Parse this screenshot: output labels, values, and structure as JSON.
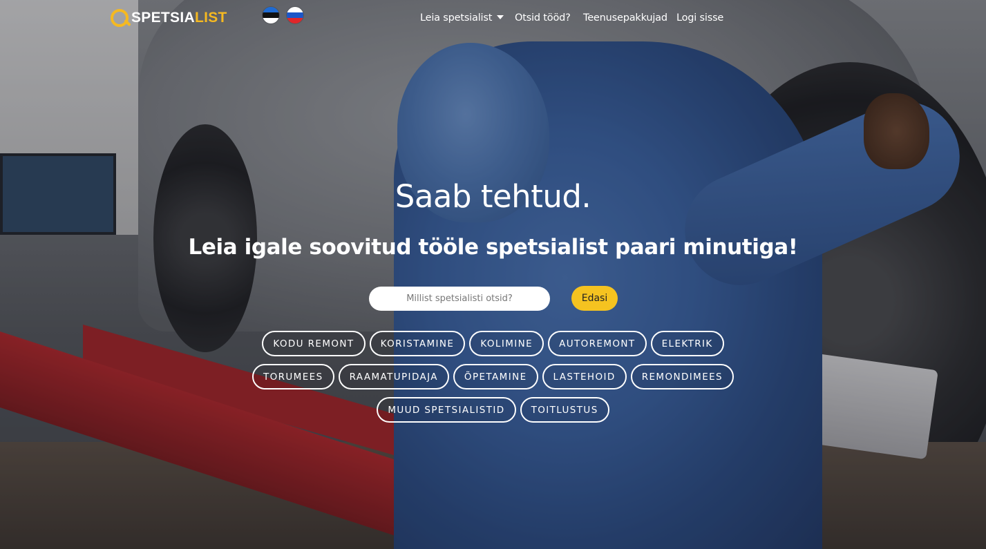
{
  "header": {
    "logo": {
      "part1": "SPETSIA",
      "part2": "LIST"
    },
    "languages": [
      {
        "code": "et",
        "icon": "estonia-flag-icon"
      },
      {
        "code": "ru",
        "icon": "russia-flag-icon"
      }
    ],
    "nav": [
      {
        "label": "Leia spetsialist",
        "has_dropdown": true
      },
      {
        "label": "Otsid tööd?"
      },
      {
        "label": "Teenusepakkujad"
      },
      {
        "label": "Logi sisse"
      }
    ]
  },
  "hero": {
    "title": "Saab tehtud.",
    "subtitle": "Leia igale soovitud tööle spetsialist paari minutiga!",
    "search": {
      "placeholder": "Millist spetsialisti otsid?",
      "value": "",
      "button_label": "Edasi"
    }
  },
  "categories": [
    "KODU REMONT",
    "KORISTAMINE",
    "KOLIMINE",
    "AUTOREMONT",
    "ELEKTRIK",
    "TORUMEES",
    "RAAMATUPIDAJA",
    "ÕPETAMINE",
    "LASTEHOID",
    "REMONDIMEES",
    "MUUD SPETSIALISTID",
    "TOITLUSTUS"
  ],
  "colors": {
    "accent": "#f5c320",
    "logo_accent": "#f5b921",
    "text": "#ffffff"
  }
}
